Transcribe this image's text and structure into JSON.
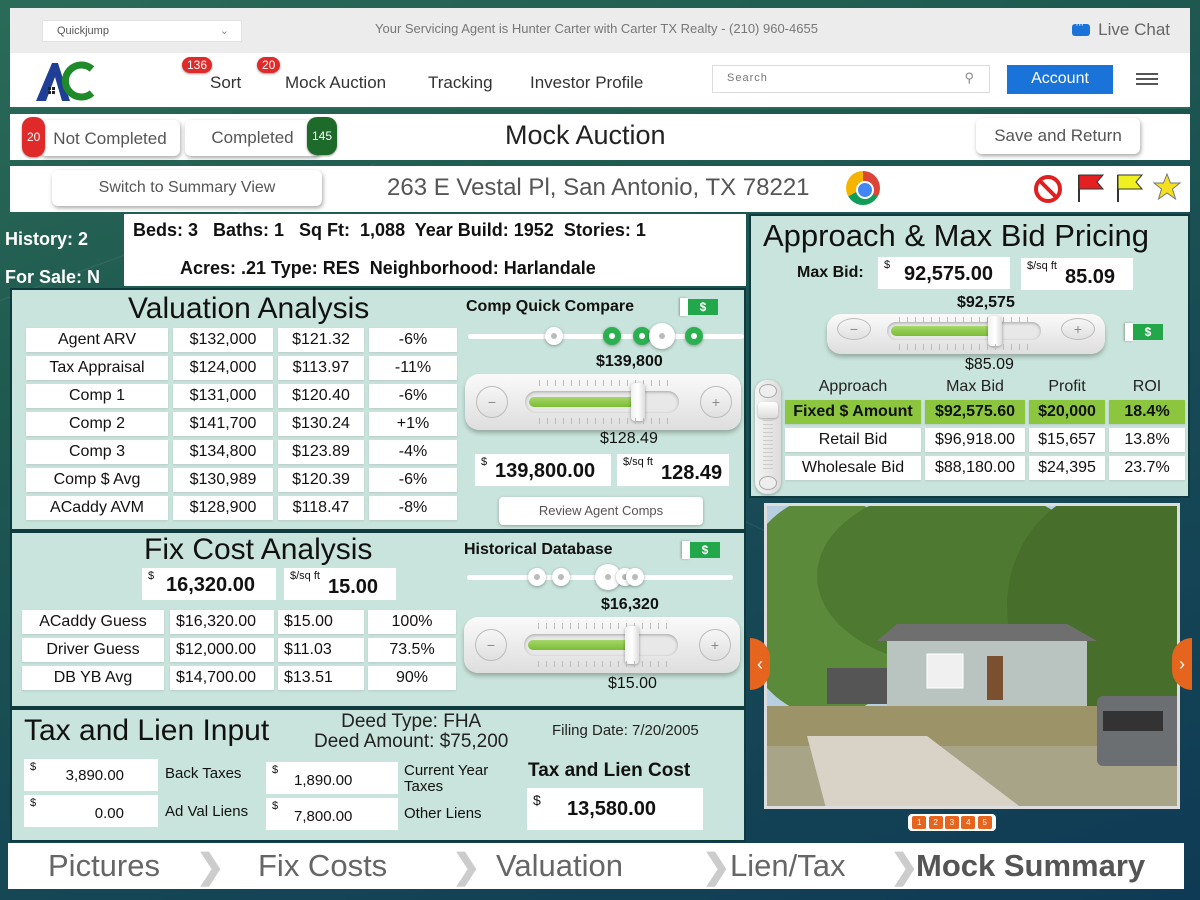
{
  "topbar": {
    "quickjump": {
      "value": "Quickjump"
    },
    "agent_text": "Your Servicing Agent is Hunter Carter with Carter TX Realty - (210) 960-4655",
    "live_chat_label": "Live Chat"
  },
  "navbar": {
    "items": [
      {
        "label": "Sort",
        "badge": "136"
      },
      {
        "label": "Mock Auction",
        "badge": "20"
      },
      {
        "label": "Tracking"
      },
      {
        "label": "Investor Profile"
      }
    ],
    "search_placeholder": "Search",
    "account_label": "Account"
  },
  "status_bar": {
    "not_completed_label": "Not Completed",
    "not_completed_count": "20",
    "completed_label": "Completed",
    "completed_count": "145",
    "title": "Mock Auction",
    "save_return_label": "Save and Return"
  },
  "address_bar": {
    "summary_view_label": "Switch to Summary View",
    "address": "263 E Vestal Pl, San Antonio, TX 78221"
  },
  "property": {
    "history": "History: 2",
    "for_sale": "For Sale: N",
    "line1": "Beds: 3   Baths: 1   Sq Ft:  1,088  Year Build: 1952  Stories: 1",
    "line2": "Acres: .21 Type: RES  Neighborhood: Harlandale"
  },
  "valuation": {
    "title": "Valuation Analysis",
    "rows": [
      {
        "label": "Agent ARV",
        "value": "$132,000",
        "per_sqft": "$121.32",
        "diff": "-6%"
      },
      {
        "label": "Tax Appraisal",
        "value": "$124,000",
        "per_sqft": "$113.97",
        "diff": "-11%"
      },
      {
        "label": "Comp 1",
        "value": "$131,000",
        "per_sqft": "$120.40",
        "diff": "-6%"
      },
      {
        "label": "Comp 2",
        "value": "$141,700",
        "per_sqft": "$130.24",
        "diff": "+1%"
      },
      {
        "label": "Comp 3",
        "value": "$134,800",
        "per_sqft": "$123.89",
        "diff": "-4%"
      },
      {
        "label": "Comp $ Avg",
        "value": "$130,989",
        "per_sqft": "$120.39",
        "diff": "-6%"
      },
      {
        "label": "ACaddy AVM",
        "value": "$128,900",
        "per_sqft": "$118.47",
        "diff": "-8%"
      }
    ]
  },
  "comp_quick_compare": {
    "title": "Comp Quick Compare",
    "toggle_label": "$",
    "slider_top_label": "$139,800",
    "slider_bottom_label": "$128.49",
    "slider_fraction": 0.75,
    "value_currency": "$",
    "value": "139,800.00",
    "per_sqft_unit": "$/sq ft",
    "per_sqft": "128.49",
    "review_label": "Review Agent Comps",
    "minus": "−",
    "plus": "+"
  },
  "fix_cost": {
    "title": "Fix Cost Analysis",
    "value_currency": "$",
    "value": "16,320.00",
    "per_sqft_unit": "$/sq ft",
    "per_sqft": "15.00",
    "rows": [
      {
        "label": "ACaddy Guess",
        "value": "$16,320.00",
        "per_sqft": "$15.00",
        "pct": "100%"
      },
      {
        "label": "Driver Guess",
        "value": "$12,000.00",
        "per_sqft": "$11.03",
        "pct": "73.5%"
      },
      {
        "label": "DB YB Avg",
        "value": "$14,700.00",
        "per_sqft": "$13.51",
        "pct": "90%"
      }
    ]
  },
  "historical_db": {
    "title": "Historical Database",
    "toggle_label": "$",
    "slider_top_label": "$16,320",
    "slider_bottom_label": "$15.00",
    "slider_fraction": 0.72,
    "minus": "−",
    "plus": "+"
  },
  "tax_lien": {
    "title": "Tax and Lien Input",
    "deed_type": "Deed Type: FHA",
    "deed_amount": "Deed Amount: $75,200",
    "filing_date": "Filing Date: 7/20/2005",
    "currency": "$",
    "back_taxes": {
      "value": "3,890.00",
      "label": "Back Taxes"
    },
    "current_year_taxes": {
      "value": "1,890.00",
      "label": "Current Year Taxes"
    },
    "ad_val_liens": {
      "value": "0.00",
      "label": "Ad Val Liens"
    },
    "other_liens": {
      "value": "7,800.00",
      "label": "Other Liens"
    },
    "cost_title": "Tax and Lien Cost",
    "cost_value": "13,580.00"
  },
  "max_bid": {
    "title": "Approach & Max Bid Pricing",
    "label": "Max Bid:",
    "currency": "$",
    "value": "92,575.00",
    "per_sqft_unit": "$/sq ft",
    "per_sqft": "85.09",
    "slider_top_label": "$92,575",
    "slider_bottom_label": "$85.09",
    "slider_fraction": 0.72,
    "toggle_label": "$",
    "minus": "−",
    "plus": "+",
    "headers": [
      "Approach",
      "Max Bid",
      "Profit",
      "ROI"
    ],
    "rows": [
      {
        "approach": "Fixed $ Amount",
        "max_bid": "$92,575.60",
        "profit": "$20,000",
        "roi": "18.4%",
        "highlight": true
      },
      {
        "approach": "Retail Bid",
        "max_bid": "$96,918.00",
        "profit": "$15,657",
        "roi": "13.8%"
      },
      {
        "approach": "Wholesale Bid",
        "max_bid": "$88,180.00",
        "profit": "$24,395",
        "roi": "23.7%"
      }
    ]
  },
  "gallery": {
    "prev": "‹",
    "next": "›",
    "pages": [
      "1",
      "2",
      "3",
      "4",
      "5"
    ],
    "current_page": 1
  },
  "bottom_nav": {
    "items": [
      "Pictures",
      "Fix Costs",
      "Valuation",
      "Lien/Tax",
      "Mock Summary"
    ],
    "active": "Mock Summary",
    "separator": "❯"
  },
  "colors": {
    "accent_blue": "#1a73d9",
    "badge_red": "#e02a2a",
    "badge_green": "#1e6a2a",
    "panel_bg": "#c9e4dc",
    "highlight_green": "#8cc63f",
    "toggle_green": "#22a84a",
    "gallery_orange": "#e5641e"
  }
}
